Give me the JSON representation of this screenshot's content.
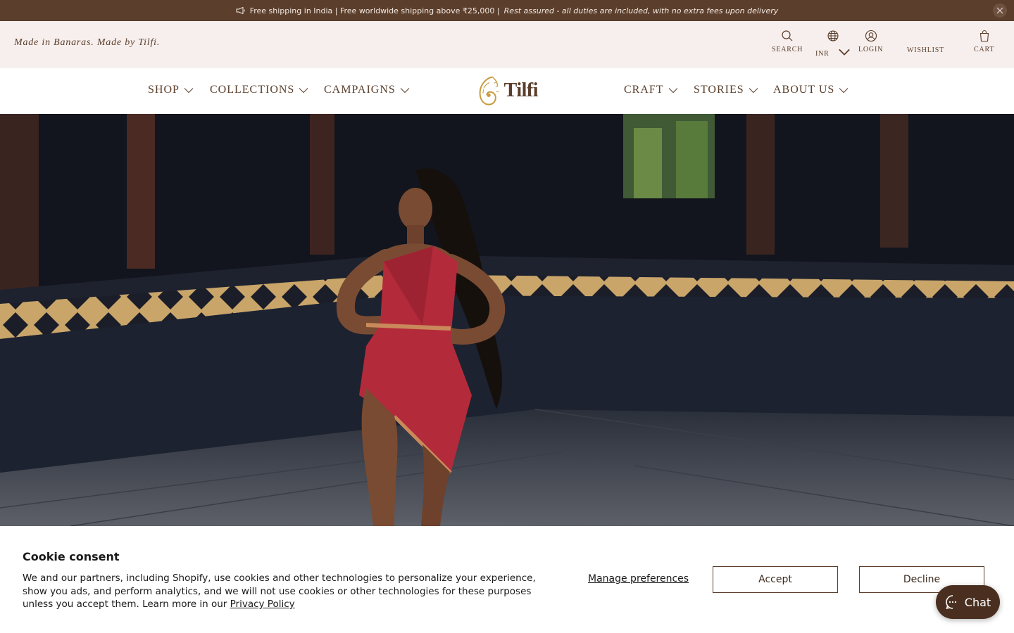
{
  "announcement": {
    "text_main": "Free shipping in India | Free worldwide shipping above ₹25,000 |",
    "text_italic": "Rest assured - all duties are included, with no extra fees upon delivery"
  },
  "utility": {
    "tagline": "Made in Banaras. Made by Tilfi.",
    "search_label": "SEARCH",
    "currency_label": "INR",
    "login_label": "LOGIN",
    "wishlist_label": "WISHLIST",
    "cart_label": "CART"
  },
  "nav": {
    "left": [
      {
        "label": "SHOP"
      },
      {
        "label": "COLLECTIONS"
      },
      {
        "label": "CAMPAIGNS"
      }
    ],
    "right": [
      {
        "label": "CRAFT"
      },
      {
        "label": "STORIES"
      },
      {
        "label": "ABOUT US"
      }
    ],
    "logo_text": "Tilfi"
  },
  "cookie": {
    "title": "Cookie consent",
    "body": "We and our partners, including Shopify, use cookies and other technologies to personalize your experience, show you ads, and perform analytics, and we will not use cookies or other technologies for these purposes unless you accept them. Learn more in our",
    "link": "Privacy Policy",
    "manage": "Manage preferences",
    "accept": "Accept",
    "decline": "Decline"
  },
  "chat": {
    "label": "Chat"
  },
  "colors": {
    "brand_brown": "#5b3f2c",
    "utility_bg": "#f7efed",
    "saree_red": "#b32b3b"
  }
}
